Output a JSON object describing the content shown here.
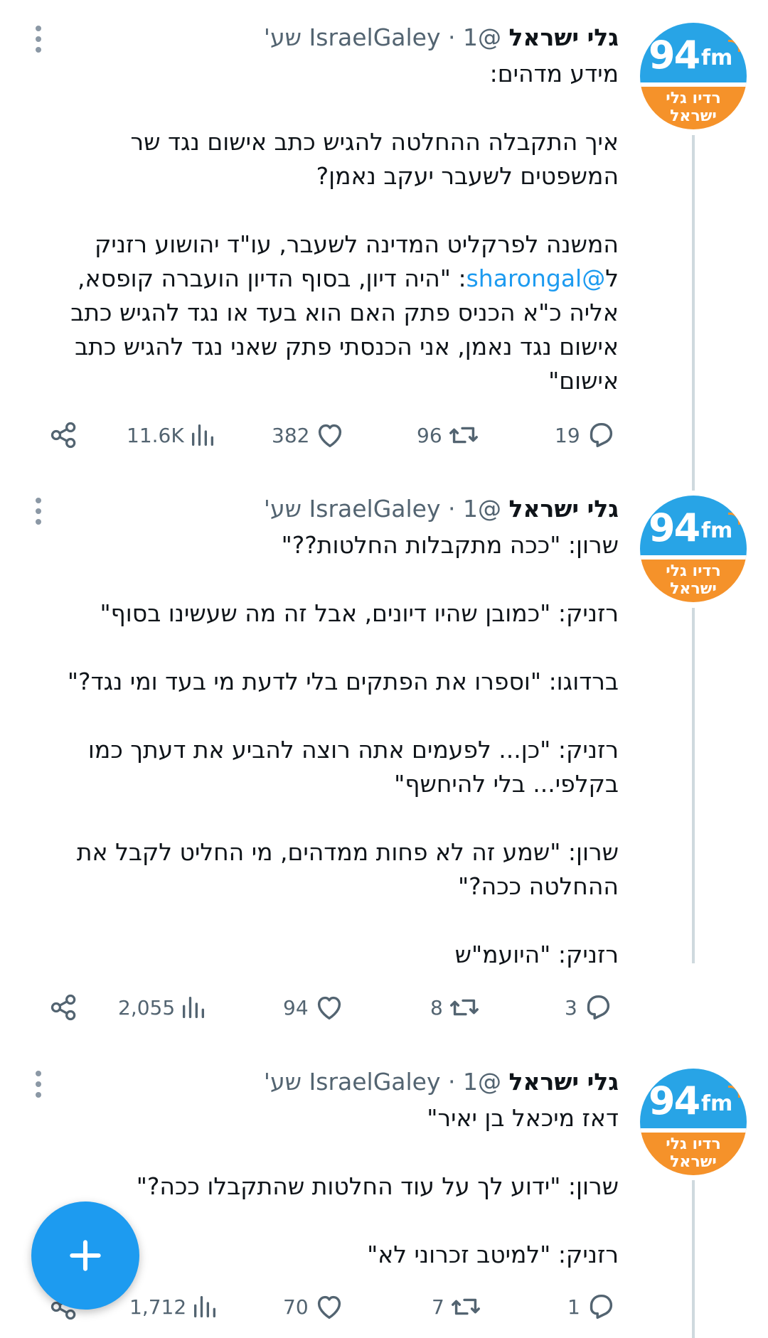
{
  "tweets": [
    {
      "author_name": "גלי ישראל",
      "handle": "@IsraelGaley",
      "time": " · 1 שע'",
      "avatar": {
        "number": "94",
        "unit": "fm",
        "station": "רדיו גלי ישראל"
      },
      "lines": [
        "מידע מדהים:",
        "",
        "איך התקבלה ההחלטה להגיש כתב אישום נגד שר",
        "המשפטים לשעבר יעקב נאמן?",
        "",
        "המשנה לפרקליט המדינה לשעבר, עו\"ד יהושוע רזניק"
      ],
      "mention_line": {
        "prefix": "ל",
        "mention": "@sharongal",
        "rest": ": \"היה דיון, בסוף הדיון הועברה קופסא,"
      },
      "lines_after": [
        "אליה כ\"א הכניס פתק האם הוא בעד או נגד להגיש כתב",
        "אישום נגד נאמן, אני הכנסתי פתק שאני נגד להגיש כתב",
        "אישום\""
      ],
      "stats": {
        "replies": "19",
        "retweets": "96",
        "likes": "382",
        "views": "11.6K"
      }
    },
    {
      "author_name": "גלי ישראל",
      "handle": "@IsraelGaley",
      "time": " · 1 שע'",
      "avatar": {
        "number": "94",
        "unit": "fm",
        "station": "רדיו גלי ישראל"
      },
      "lines": [
        "שרון: \"ככה מתקבלות החלטות??\"",
        "",
        "רזניק: \"כמובן שהיו דיונים, אבל זה מה שעשינו בסוף\"",
        "",
        "ברדוגו: \"וספרו את הפתקים בלי לדעת מי בעד ומי נגד?\"",
        "",
        "רזניק: \"כן... לפעמים אתה רוצה להביע את דעתך כמו",
        "בקלפי... בלי להיחשף\"",
        "",
        "שרון: \"שמע זה לא פחות ממדהים, מי החליט לקבל את",
        "ההחלטה ככה?\"",
        "",
        "רזניק: \"היועמ\"ש"
      ],
      "stats": {
        "replies": "3",
        "retweets": "8",
        "likes": "94",
        "views": "2,055"
      }
    },
    {
      "author_name": "גלי ישראל",
      "handle": "@IsraelGaley",
      "time": " · 1 שע'",
      "avatar": {
        "number": "94",
        "unit": "fm",
        "station": "רדיו גלי ישראל"
      },
      "lines": [
        "דאז מיכאל בן יאיר\"",
        "",
        "שרון: \"ידוע לך על עוד החלטות שהתקבלו ככה?\"",
        "",
        "רזניק: \"למיטב זכרוני לא\""
      ],
      "stats": {
        "replies": "1",
        "retweets": "7",
        "likes": "70",
        "views": "1,712"
      }
    }
  ],
  "fab_label": "+",
  "colors": {
    "accent": "#1d9bf0",
    "avatar_blue": "#28a4e6",
    "avatar_orange": "#f5922a",
    "muted": "#536471"
  }
}
